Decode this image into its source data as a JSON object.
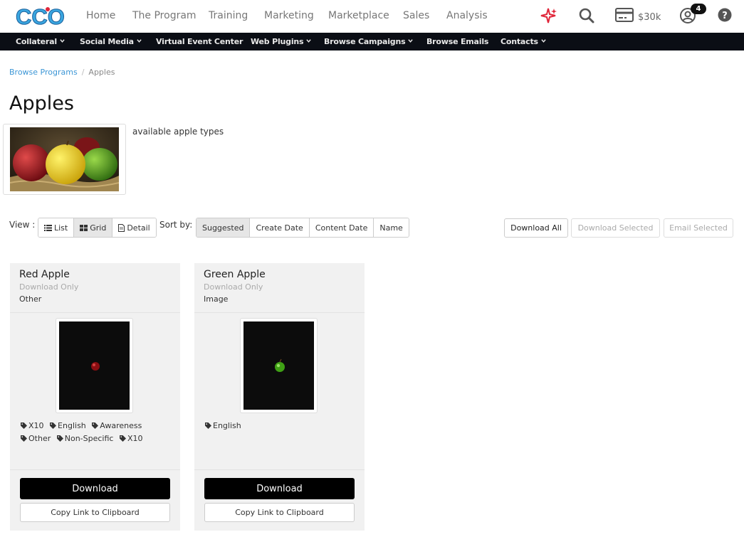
{
  "top_nav": {
    "items": [
      "Home",
      "The Program",
      "Training",
      "Marketplace",
      "Sales",
      "Analysis"
    ],
    "marketing": "Marketing",
    "balance": "$30k",
    "notification_count": "4"
  },
  "sub_nav": {
    "items": [
      "Collateral",
      "Social Media",
      "Virtual Event Center",
      "Web Plugins",
      "Browse Campaigns",
      "Browse Emails",
      "Contacts"
    ]
  },
  "breadcrumb": {
    "root": "Browse Programs",
    "separator": "/",
    "current": "Apples"
  },
  "page": {
    "title": "Apples",
    "description": "available apple types"
  },
  "toolbar": {
    "view_label": "View :",
    "view_options": [
      "List",
      "Grid",
      "Detail"
    ],
    "sort_label": "Sort by:",
    "sort_options": [
      "Suggested",
      "Create Date",
      "Content Date",
      "Name"
    ],
    "download_all": "Download All",
    "download_selected": "Download Selected",
    "email_selected": "Email Selected"
  },
  "cards": [
    {
      "title": "Red Apple",
      "subtitle": "Download Only",
      "type": "Other",
      "tags": [
        "X10",
        "English",
        "Awareness",
        "Other",
        "Non-Specific",
        "X10"
      ],
      "download": "Download",
      "copy": "Copy Link to Clipboard",
      "apple_color": "#8b0e12"
    },
    {
      "title": "Green Apple",
      "subtitle": "Download Only",
      "type": "Image",
      "tags": [
        "English"
      ],
      "download": "Download",
      "copy": "Copy Link to Clipboard",
      "apple_color": "#3fa015"
    }
  ],
  "colors": {
    "accent": "#3c96d6",
    "subnav_bg": "#0b0e15",
    "logo_blue": "#3aa6e0",
    "sparkle_red": "#e0263a"
  }
}
